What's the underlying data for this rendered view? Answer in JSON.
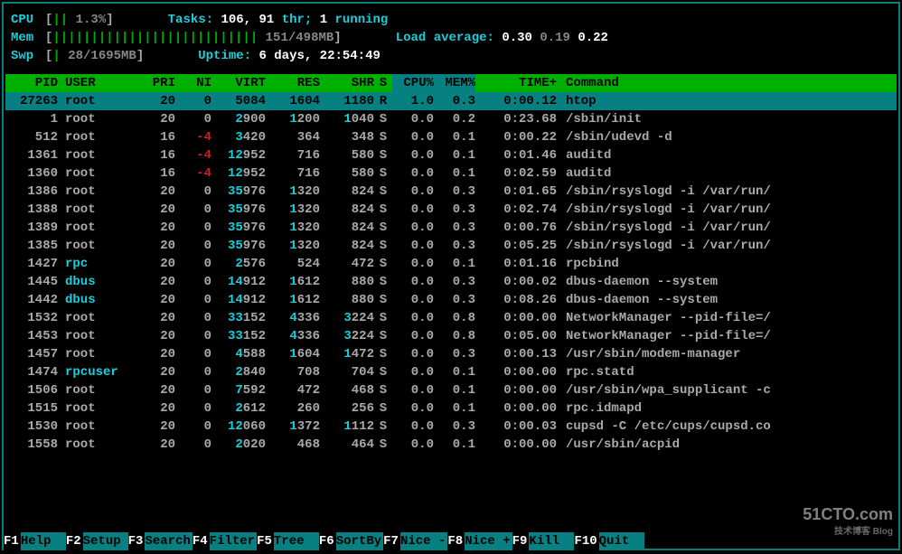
{
  "meters": {
    "cpu": {
      "label": "CPU",
      "value_text": "1.3%",
      "bars": 2
    },
    "mem": {
      "label": "Mem",
      "value_text": "151/498MB",
      "bars": 27
    },
    "swp": {
      "label": "Swp",
      "value_text": "28/1695MB",
      "bars": 1
    }
  },
  "stats": {
    "tasks_label": "Tasks: ",
    "tasks_val": "106, ",
    "thr_val": "91 ",
    "thr_label": "thr; ",
    "running_val": "1 ",
    "running_label": "running",
    "load_label": "Load average: ",
    "load1": "0.30 ",
    "load2": "0.19 ",
    "load3": "0.22",
    "uptime_label": "Uptime: ",
    "uptime_val": "6 days, 22:54:49"
  },
  "columns": {
    "pid": "PID",
    "user": "USER",
    "pri": "PRI",
    "ni": "NI",
    "virt": "VIRT",
    "res": "RES",
    "shr": "SHR",
    "s": "S",
    "cpu": "CPU%",
    "mem": "MEM%",
    "time": "TIME+",
    "cmd": "Command"
  },
  "processes": [
    {
      "pid": "27263",
      "user": "root",
      "pri": "20",
      "ni": "0",
      "virt": "5084",
      "res": "1604",
      "shr": "1180",
      "s": "R",
      "cpu": "1.0",
      "mem": "0.3",
      "time": "0:00.12",
      "cmd": "htop",
      "selected": true
    },
    {
      "pid": "1",
      "user": "root",
      "pri": "20",
      "ni": "0",
      "virt": "2900",
      "res": "1200",
      "shr": "1040",
      "s": "S",
      "cpu": "0.0",
      "mem": "0.2",
      "time": "0:23.68",
      "cmd": "/sbin/init"
    },
    {
      "pid": "512",
      "user": "root",
      "pri": "16",
      "ni": "-4",
      "virt": "3420",
      "res": "364",
      "shr": "348",
      "s": "S",
      "cpu": "0.0",
      "mem": "0.1",
      "time": "0:00.22",
      "cmd": "/sbin/udevd -d",
      "ni_red": true
    },
    {
      "pid": "1361",
      "user": "root",
      "pri": "16",
      "ni": "-4",
      "virt": "12952",
      "res": "716",
      "shr": "580",
      "s": "S",
      "cpu": "0.0",
      "mem": "0.1",
      "time": "0:01.46",
      "cmd": "auditd",
      "ni_red": true
    },
    {
      "pid": "1360",
      "user": "root",
      "pri": "16",
      "ni": "-4",
      "virt": "12952",
      "res": "716",
      "shr": "580",
      "s": "S",
      "cpu": "0.0",
      "mem": "0.1",
      "time": "0:02.59",
      "cmd": "auditd",
      "ni_red": true
    },
    {
      "pid": "1386",
      "user": "root",
      "pri": "20",
      "ni": "0",
      "virt": "35976",
      "res": "1320",
      "shr": "824",
      "s": "S",
      "cpu": "0.0",
      "mem": "0.3",
      "time": "0:01.65",
      "cmd": "/sbin/rsyslogd -i /var/run/"
    },
    {
      "pid": "1388",
      "user": "root",
      "pri": "20",
      "ni": "0",
      "virt": "35976",
      "res": "1320",
      "shr": "824",
      "s": "S",
      "cpu": "0.0",
      "mem": "0.3",
      "time": "0:02.74",
      "cmd": "/sbin/rsyslogd -i /var/run/"
    },
    {
      "pid": "1389",
      "user": "root",
      "pri": "20",
      "ni": "0",
      "virt": "35976",
      "res": "1320",
      "shr": "824",
      "s": "S",
      "cpu": "0.0",
      "mem": "0.3",
      "time": "0:00.76",
      "cmd": "/sbin/rsyslogd -i /var/run/"
    },
    {
      "pid": "1385",
      "user": "root",
      "pri": "20",
      "ni": "0",
      "virt": "35976",
      "res": "1320",
      "shr": "824",
      "s": "S",
      "cpu": "0.0",
      "mem": "0.3",
      "time": "0:05.25",
      "cmd": "/sbin/rsyslogd -i /var/run/"
    },
    {
      "pid": "1427",
      "user": "rpc",
      "pri": "20",
      "ni": "0",
      "virt": "2576",
      "res": "524",
      "shr": "472",
      "s": "S",
      "cpu": "0.0",
      "mem": "0.1",
      "time": "0:01.16",
      "cmd": "rpcbind",
      "user_cyan": true
    },
    {
      "pid": "1445",
      "user": "dbus",
      "pri": "20",
      "ni": "0",
      "virt": "14912",
      "res": "1612",
      "shr": "880",
      "s": "S",
      "cpu": "0.0",
      "mem": "0.3",
      "time": "0:00.02",
      "cmd": "dbus-daemon --system",
      "user_cyan": true
    },
    {
      "pid": "1442",
      "user": "dbus",
      "pri": "20",
      "ni": "0",
      "virt": "14912",
      "res": "1612",
      "shr": "880",
      "s": "S",
      "cpu": "0.0",
      "mem": "0.3",
      "time": "0:08.26",
      "cmd": "dbus-daemon --system",
      "user_cyan": true
    },
    {
      "pid": "1532",
      "user": "root",
      "pri": "20",
      "ni": "0",
      "virt": "33152",
      "res": "4336",
      "shr": "3224",
      "s": "S",
      "cpu": "0.0",
      "mem": "0.8",
      "time": "0:00.00",
      "cmd": "NetworkManager --pid-file=/"
    },
    {
      "pid": "1453",
      "user": "root",
      "pri": "20",
      "ni": "0",
      "virt": "33152",
      "res": "4336",
      "shr": "3224",
      "s": "S",
      "cpu": "0.0",
      "mem": "0.8",
      "time": "0:05.00",
      "cmd": "NetworkManager --pid-file=/"
    },
    {
      "pid": "1457",
      "user": "root",
      "pri": "20",
      "ni": "0",
      "virt": "4588",
      "res": "1604",
      "shr": "1472",
      "s": "S",
      "cpu": "0.0",
      "mem": "0.3",
      "time": "0:00.13",
      "cmd": "/usr/sbin/modem-manager"
    },
    {
      "pid": "1474",
      "user": "rpcuser",
      "pri": "20",
      "ni": "0",
      "virt": "2840",
      "res": "708",
      "shr": "704",
      "s": "S",
      "cpu": "0.0",
      "mem": "0.1",
      "time": "0:00.00",
      "cmd": "rpc.statd",
      "user_cyan": true
    },
    {
      "pid": "1506",
      "user": "root",
      "pri": "20",
      "ni": "0",
      "virt": "7592",
      "res": "472",
      "shr": "468",
      "s": "S",
      "cpu": "0.0",
      "mem": "0.1",
      "time": "0:00.00",
      "cmd": "/usr/sbin/wpa_supplicant -c"
    },
    {
      "pid": "1515",
      "user": "root",
      "pri": "20",
      "ni": "0",
      "virt": "2612",
      "res": "260",
      "shr": "256",
      "s": "S",
      "cpu": "0.0",
      "mem": "0.1",
      "time": "0:00.00",
      "cmd": "rpc.idmapd"
    },
    {
      "pid": "1530",
      "user": "root",
      "pri": "20",
      "ni": "0",
      "virt": "12060",
      "res": "1372",
      "shr": "1112",
      "s": "S",
      "cpu": "0.0",
      "mem": "0.3",
      "time": "0:00.03",
      "cmd": "cupsd -C /etc/cups/cupsd.co"
    },
    {
      "pid": "1558",
      "user": "root",
      "pri": "20",
      "ni": "0",
      "virt": "2020",
      "res": "468",
      "shr": "464",
      "s": "S",
      "cpu": "0.0",
      "mem": "0.1",
      "time": "0:00.00",
      "cmd": "/usr/sbin/acpid"
    }
  ],
  "footer": [
    {
      "key": "F1",
      "label": "Help"
    },
    {
      "key": "F2",
      "label": "Setup"
    },
    {
      "key": "F3",
      "label": "Search"
    },
    {
      "key": "F4",
      "label": "Filter"
    },
    {
      "key": "F5",
      "label": "Tree"
    },
    {
      "key": "F6",
      "label": "SortBy"
    },
    {
      "key": "F7",
      "label": "Nice -"
    },
    {
      "key": "F8",
      "label": "Nice +"
    },
    {
      "key": "F9",
      "label": "Kill"
    },
    {
      "key": "F10",
      "label": "Quit"
    }
  ],
  "watermark": {
    "main": "51CTO.com",
    "sub": "技术博客 Blog"
  }
}
